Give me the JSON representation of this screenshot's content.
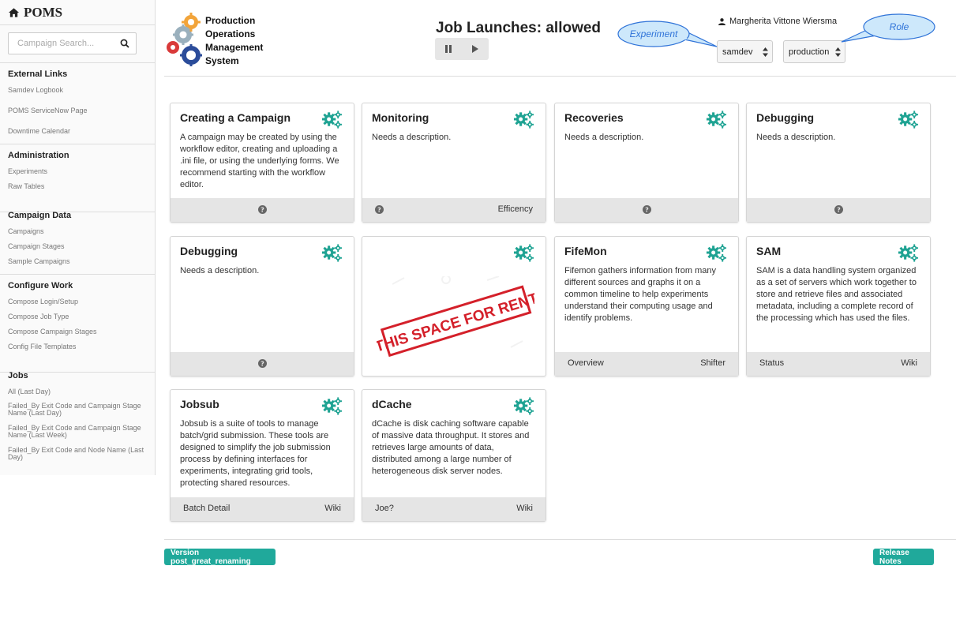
{
  "brand": {
    "name": "POMS"
  },
  "search": {
    "placeholder": "Campaign Search..."
  },
  "sidebar": {
    "sections": [
      {
        "title": "External Links",
        "links": [
          "Samdev Logbook",
          "POMS ServiceNow Page",
          "Downtime Calendar"
        ]
      },
      {
        "title": "Administration",
        "links": [
          "Experiments",
          "Raw Tables"
        ]
      },
      {
        "title": "Campaign Data",
        "links": [
          "Campaigns",
          "Campaign Stages",
          "Sample Campaigns"
        ]
      },
      {
        "title": "Configure Work",
        "links": [
          "Compose Login/Setup",
          "Compose Job Type",
          "Compose Campaign Stages",
          "Config File Templates"
        ]
      },
      {
        "title": "Jobs",
        "links": [
          "All (Last Day)",
          "Failed_By Exit Code and Campaign Stage Name (Last Day)",
          "Failed_By Exit Code and Campaign Stage Name (Last Week)",
          "Failed_By Exit Code and Node Name (Last Day)"
        ]
      }
    ]
  },
  "header": {
    "logo_lines": [
      "Production",
      "Operations",
      "Management",
      "System"
    ],
    "job_launches": "Job Launches: allowed",
    "user_name": "Margherita Vittone Wiersma",
    "experiment_value": "samdev",
    "role_value": "production",
    "experiment_callout": "Experiment",
    "role_callout": "Role"
  },
  "cards": [
    {
      "title": "Creating a Campaign",
      "desc": "A campaign may be created by using the workflow editor, creating and uploading a .ini file, or using the underlying forms. We recommend starting with the workflow editor.",
      "footer_left": "",
      "footer_right": ""
    },
    {
      "title": "Monitoring",
      "desc": "Needs a description.",
      "footer_left": "",
      "footer_right": "Efficency"
    },
    {
      "title": "Recoveries",
      "desc": "Needs a description.",
      "footer_left": "",
      "footer_right": ""
    },
    {
      "title": "Debugging",
      "desc": "Needs a description.",
      "footer_left": "",
      "footer_right": ""
    },
    {
      "title": "Debugging",
      "desc": "Needs a description.",
      "footer_left": "",
      "footer_right": ""
    },
    {
      "title": "",
      "desc": "",
      "stamp": "THIS SPACE FOR RENT"
    },
    {
      "title": "FifeMon",
      "desc": "Fifemon gathers information from many different sources and graphs it on a common timeline to help experiments understand their computing usage and identify problems.",
      "footer_left": "Overview",
      "footer_right": "Shifter"
    },
    {
      "title": "SAM",
      "desc": "SAM is a data handling system organized as a set of servers which work together to store and retrieve files and associated metadata, including a complete record of the processing which has used the files.",
      "footer_left": "Status",
      "footer_right": "Wiki"
    },
    {
      "title": "Jobsub",
      "desc": "Jobsub is a suite of tools to manage batch/grid submission. These tools are designed to simplify the job submission process by defining interfaces for experiments, integrating grid tools, protecting shared resources.",
      "footer_left": "Batch Detail",
      "footer_right": "Wiki"
    },
    {
      "title": "dCache",
      "desc": "dCache is disk caching software capable of massive data throughput. It stores and retrieves large amounts of data, distributed among a large number of heterogeneous disk server nodes.",
      "footer_left": "Joe?",
      "footer_right": "Wiki"
    }
  ],
  "footer": {
    "version": "Version post_great_renaming",
    "release_notes": "Release Notes"
  },
  "colors": {
    "accent": "#20a99b",
    "gear": "#1fa393",
    "callout_fill": "#cde8fb",
    "callout_stroke": "#2f73d8",
    "stamp": "#d4202a"
  },
  "icons": [
    "home-icon",
    "search-icon",
    "pause-icon",
    "play-icon",
    "user-icon",
    "gears-icon",
    "question-circle-icon",
    "sort-arrows-icon"
  ]
}
